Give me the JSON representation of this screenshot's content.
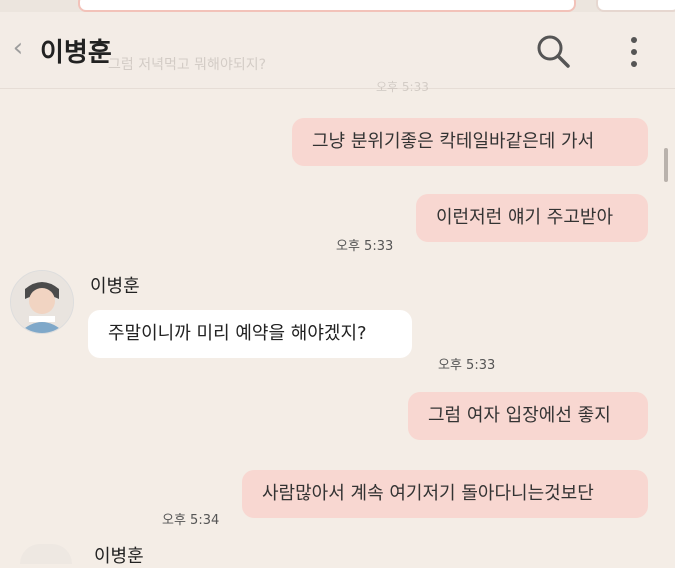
{
  "header": {
    "title": "이병훈",
    "ghost_line": "그럼 저녁먹고 뭐해야되지?",
    "ghost_time": "오후 5:33"
  },
  "messages": [
    {
      "side": "me",
      "text": "그냥 분위기좋은 칵테일바같은데 가서"
    },
    {
      "side": "me",
      "text": "이런저런 얘기 주고받아",
      "time": "오후 5:33"
    },
    {
      "side": "them",
      "text": "주말이니까 미리 예약을 해야겠지?",
      "time": "오후 5:33"
    },
    {
      "side": "me",
      "text": "그럼 여자 입장에선 좋지"
    },
    {
      "side": "me",
      "text": "사람많아서 계속 여기저기 돌아다니는것보단",
      "time": "오후 5:34"
    }
  ],
  "sender_name": "이병훈",
  "sender_name_bottom": "이병훈",
  "icons": {
    "back": "chevron-left-icon",
    "search": "search-icon",
    "more": "more-vertical-icon"
  },
  "colors": {
    "background": "#f4ede6",
    "my_bubble": "#f8d7d1",
    "their_bubble": "#ffffff"
  }
}
